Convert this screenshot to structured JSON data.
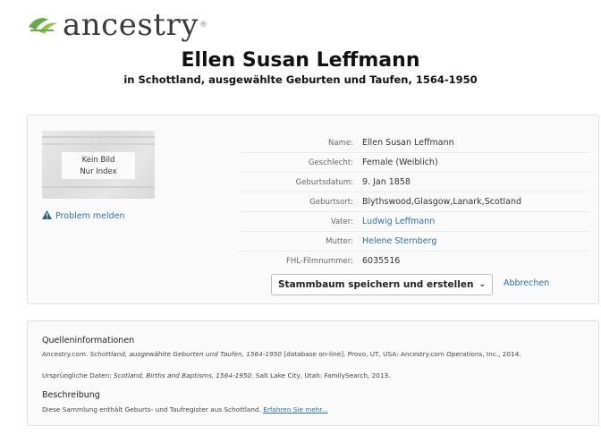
{
  "brand": {
    "name": "ancestry",
    "color": "#6aa84f"
  },
  "header": {
    "title": "Ellen Susan Leffmann",
    "subtitle": "in Schottland, ausgewählte Geburten und Taufen, 1564-1950"
  },
  "record": {
    "thumbnail": {
      "line1": "Kein Bild",
      "line2": "Nur Index"
    },
    "problem_label": "Problem melden",
    "fields": [
      {
        "label": "Name:",
        "value": "Ellen Susan Leffmann",
        "link": false
      },
      {
        "label": "Geschlecht:",
        "value": "Female (Weiblich)",
        "link": false
      },
      {
        "label": "Geburtsdatum:",
        "value": "9. Jan 1858",
        "link": false
      },
      {
        "label": "Geburtsort:",
        "value": "Blythswood,Glasgow,Lanark,Scotland",
        "link": false
      },
      {
        "label": "Vater:",
        "value": "Ludwig Leffmann",
        "link": true
      },
      {
        "label": "Mutter:",
        "value": "Helene Sternberg",
        "link": true
      },
      {
        "label": "FHL-Filmnummer:",
        "value": "6035516",
        "link": false
      }
    ],
    "save_button": "Stammbaum speichern und erstellen",
    "cancel_label": "Abbrechen"
  },
  "source": {
    "heading": "Quelleninformationen",
    "citation_prefix": "Ancestry.com.",
    "citation_title": "Schottland, ausgewählte Geburten und Taufen, 1564-1950",
    "citation_suffix": "[database on-line]. Provo, UT, USA: Ancestry.com Operations, Inc., 2014.",
    "original_prefix": "Ursprüngliche Daten:",
    "original_title": "Scotland, Births and Baptisms, 1564-1950.",
    "original_suffix": "Salt Lake City, Utah: FamilySearch, 2013.",
    "description_heading": "Beschreibung",
    "description_text": "Diese Sammlung enthält Geburts- und Taufregister aus Schottland.",
    "learn_more": "Erfahren Sie mehr..."
  }
}
